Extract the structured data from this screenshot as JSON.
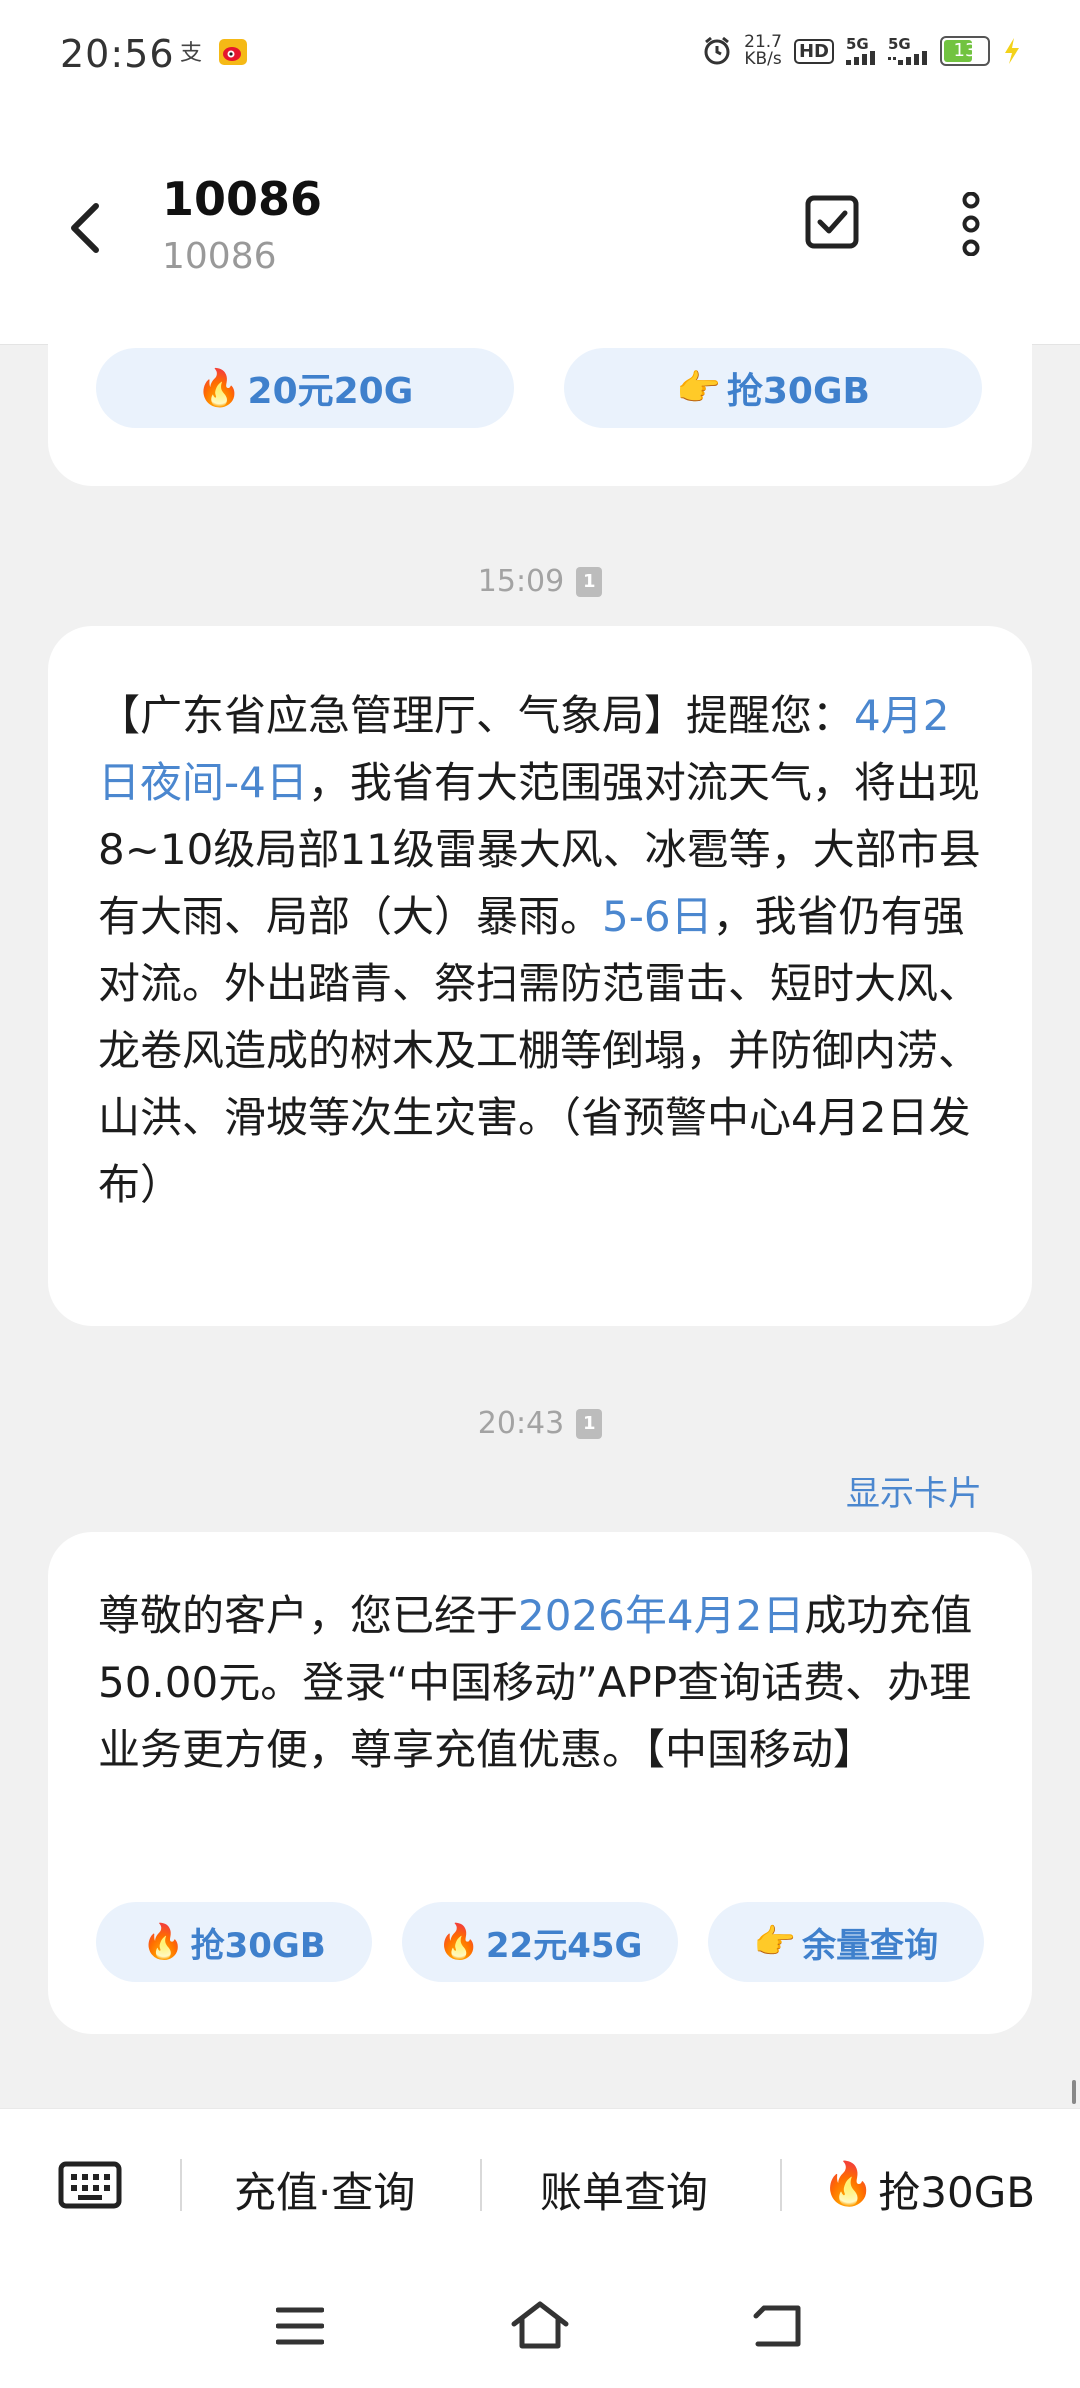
{
  "status_bar": {
    "time": "20:56",
    "net_speed_value": "21.7",
    "net_speed_unit": "KB/s",
    "hd_label": "HD",
    "signal1_label": "5G",
    "signal2_label": "5G",
    "battery_level": "13",
    "icons": [
      "alipay-icon",
      "weibo-icon",
      "alarm-icon",
      "hd-voice-icon",
      "signal-5g-icon",
      "signal-5g-icon",
      "battery-icon",
      "charging-icon"
    ]
  },
  "header": {
    "title": "10086",
    "subtitle": "10086",
    "icons": [
      "back-arrow-icon",
      "select-checkbox-icon",
      "more-vertical-icon"
    ]
  },
  "messages": [
    {
      "partial": true,
      "chips": [
        {
          "emoji": "🔥",
          "label": "20元20G"
        },
        {
          "emoji": "👉",
          "label": "抢30GB"
        }
      ]
    },
    {
      "time": "15:09",
      "sim": "1",
      "segments": [
        {
          "text": "【广东省应急管理厅、气象局】提醒您：",
          "hl": false
        },
        {
          "text": "4月2日夜间-4日",
          "hl": true
        },
        {
          "text": "，我省有大范围强对流天气，将出现8~10级局部11级雷暴大风、冰雹等，大部市县有大雨、局部（大）暴雨。",
          "hl": false
        },
        {
          "text": "5-6日",
          "hl": true
        },
        {
          "text": "，我省仍有强对流。外出踏青、祭扫需防范雷击、短时大风、龙卷风造成的树木及工棚等倒塌，并防御内涝、山洪、滑坡等次生灾害。（省预警中心4月2日发布）",
          "hl": false
        }
      ]
    },
    {
      "time": "20:43",
      "sim": "1",
      "show_card": "显示卡片",
      "segments": [
        {
          "text": "尊敬的客户，您已经于",
          "hl": false
        },
        {
          "text": "2026年4月2日",
          "hl": true
        },
        {
          "text": "成功充值50.00元。登录“中国移动”APP查询话费、办理业务更方便，尊享充值优惠。【中国移动】",
          "hl": false
        }
      ],
      "chips": [
        {
          "emoji": "🔥",
          "label": "抢30GB"
        },
        {
          "emoji": "🔥",
          "label": "22元45G"
        },
        {
          "emoji": "👉",
          "label": "余量查询"
        }
      ]
    }
  ],
  "quick_bar": {
    "items": [
      "充值·查询",
      "账单查询",
      "抢30GB"
    ],
    "hot_emoji": "🔥",
    "keyboard_icon": "keyboard-icon"
  },
  "nav_bar": {
    "icons": [
      "menu-icon",
      "home-icon",
      "back-icon"
    ]
  },
  "colors": {
    "accent": "#4b87cf",
    "chip_bg": "#eaf2fc",
    "background": "#f1f1f1",
    "bubble": "#ffffff"
  }
}
